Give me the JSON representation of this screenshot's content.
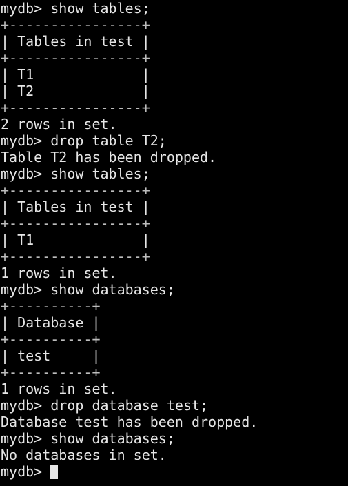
{
  "terminal": {
    "lines": [
      "mydb> show tables;",
      "+----------------+",
      "| Tables in test |",
      "+----------------+",
      "| T1             |",
      "| T2             |",
      "+----------------+",
      "2 rows in set.",
      "mydb> drop table T2;",
      "Table T2 has been dropped.",
      "mydb> show tables;",
      "+----------------+",
      "| Tables in test |",
      "+----------------+",
      "| T1             |",
      "+----------------+",
      "1 rows in set.",
      "mydb> show databases;",
      "+----------+",
      "| Database |",
      "+----------+",
      "| test     |",
      "+----------+",
      "1 rows in set.",
      "mydb> drop database test;",
      "Database test has been dropped.",
      "mydb> show databases;",
      "No databases in set."
    ],
    "prompt": "mydb>",
    "colors": {
      "background": "#000000",
      "foreground": "#e6e6e6",
      "cursor": "#e6e6e6"
    }
  }
}
